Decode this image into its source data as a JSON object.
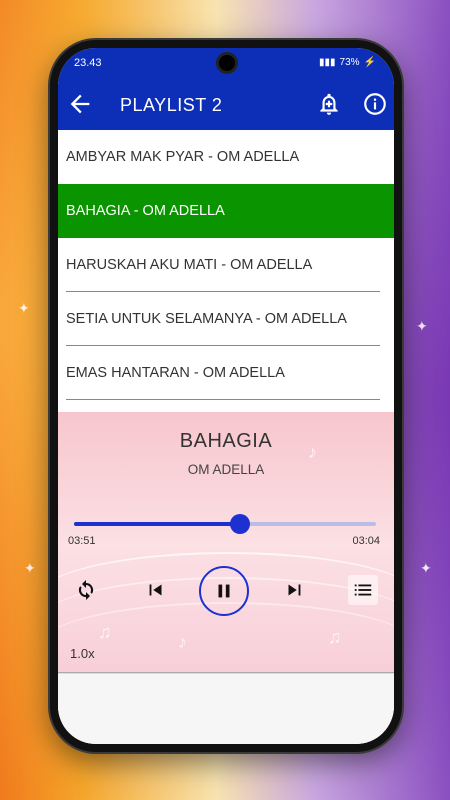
{
  "status_bar": {
    "time": "23.43",
    "battery": "73%"
  },
  "app_bar": {
    "title": "PLAYLIST 2",
    "icons": [
      "back-arrow-icon",
      "alarm-add-icon",
      "info-icon"
    ]
  },
  "playlist": {
    "tracks": [
      {
        "label": "AMBYAR MAK PYAR - OM ADELLA",
        "active": false
      },
      {
        "label": "BAHAGIA - OM ADELLA",
        "active": true
      },
      {
        "label": "HARUSKAH AKU MATI - OM ADELLA",
        "active": false
      },
      {
        "label": "SETIA UNTUK SELAMANYA - OM ADELLA",
        "active": false
      },
      {
        "label": "EMAS HANTARAN - OM ADELLA",
        "active": false
      }
    ]
  },
  "player": {
    "title": "BAHAGIA",
    "artist": "OM ADELLA",
    "time_current": "03:51",
    "time_total": "03:04",
    "progress": 0.55,
    "speed": "1.0x",
    "icons": [
      "repeat-icon",
      "skip-previous-icon",
      "pause-icon",
      "skip-next-icon",
      "queue-list-icon"
    ]
  },
  "colors": {
    "app_bar": "#0d2fb8",
    "active_track": "#0a9400",
    "accent": "#1d30d0"
  }
}
